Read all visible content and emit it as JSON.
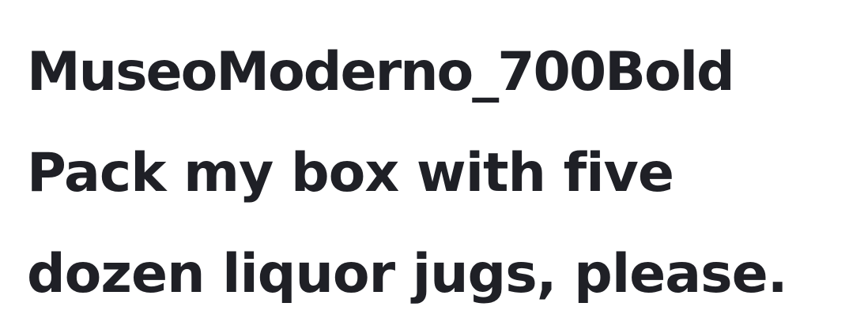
{
  "font_sample": {
    "title": "MuseoModerno_700Bold",
    "lines": [
      "Pack my box with five",
      "dozen liquor jugs, please."
    ]
  },
  "colors": {
    "text": "#1f2026",
    "background": "#ffffff"
  }
}
